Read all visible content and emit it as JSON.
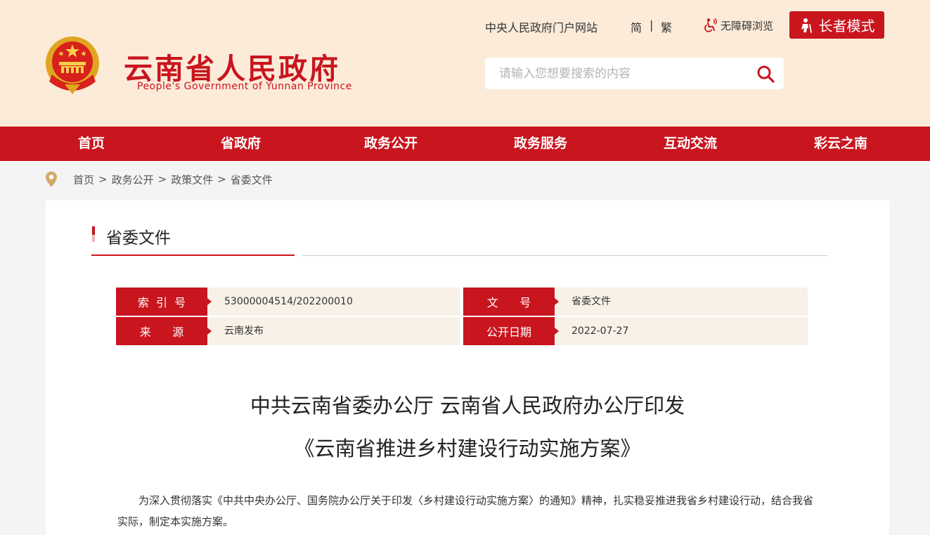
{
  "header": {
    "site_title": "云南省人民政府",
    "site_subtitle": "People's Government of Yunnan Province",
    "top_links": {
      "portal": "中央人民政府门户网站",
      "simplified": "简",
      "separator": "|",
      "traditional": "繁",
      "accessibility": "无障碍浏览"
    },
    "elder_mode": "长者模式",
    "search": {
      "placeholder": "请输入您想要搜索的内容",
      "value": ""
    }
  },
  "nav": {
    "items": [
      "首页",
      "省政府",
      "政务公开",
      "政务服务",
      "互动交流",
      "彩云之南"
    ]
  },
  "breadcrumb": [
    "首页",
    "政务公开",
    "政策文件",
    "省委文件"
  ],
  "breadcrumb_separator": ">",
  "section": {
    "title": "省委文件"
  },
  "meta": {
    "index_label": "索  引  号",
    "index_value": "53000004514/202200010",
    "doc_no_label": "文      号",
    "doc_no_value": "省委文件",
    "source_label": "来      源",
    "source_value": "云南发布",
    "date_label": "公开日期",
    "date_value": "2022-07-27"
  },
  "document": {
    "title_line1": "中共云南省委办公厅 云南省人民政府办公厅印发",
    "title_line2": "《云南省推进乡村建设行动实施方案》",
    "paragraph": "为深入贯彻落实《中共中央办公厅、国务院办公厅关于印发〈乡村建设行动实施方案〉的通知》精神，扎实稳妥推进我省乡村建设行动，结合我省实际，制定本实施方案。"
  },
  "colors": {
    "brand_red": "#c9151e",
    "header_bg": "#fcebd9",
    "meta_bg": "#f8f1e8",
    "page_bg": "#f4f4f4"
  }
}
